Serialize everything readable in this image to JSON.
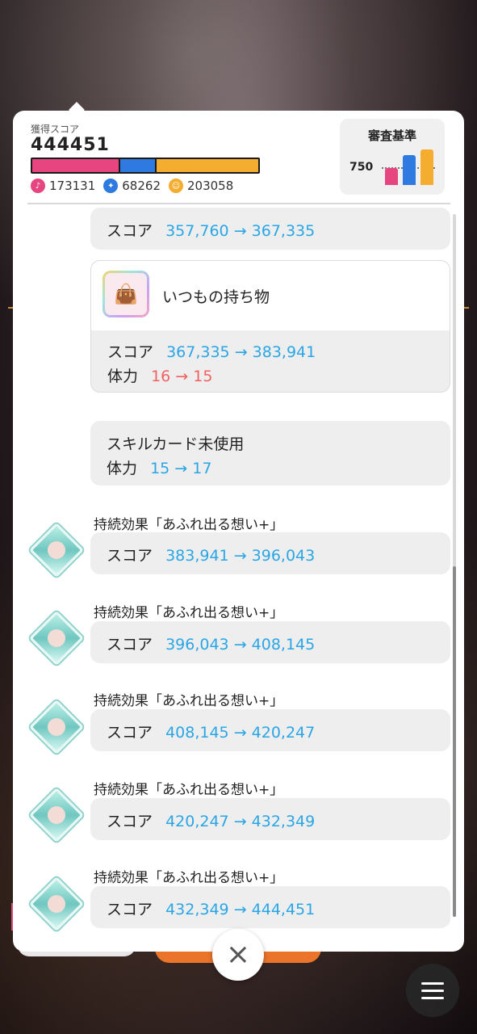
{
  "header": {
    "score_label": "獲得スコア",
    "score_value": "444451",
    "bar_segments": [
      {
        "color": "#e6457f",
        "fraction": 0.389
      },
      {
        "color": "#2f7ae0",
        "fraction": 0.154
      },
      {
        "color": "#f4ad2f",
        "fraction": 0.457
      }
    ],
    "stats": [
      {
        "icon": "microphone-icon",
        "color": "#e6457f",
        "value": "173131"
      },
      {
        "icon": "dance-icon",
        "color": "#2f7ae0",
        "value": "68262"
      },
      {
        "icon": "visual-icon",
        "color": "#f4ad2f",
        "value": "203058"
      }
    ],
    "criteria": {
      "title": "審査基準",
      "value": "750",
      "bars": [
        {
          "color": "#e6457f",
          "level": 0.45
        },
        {
          "color": "#2f7ae0",
          "level": 0.8
        },
        {
          "color": "#f4ad2f",
          "level": 0.95
        }
      ]
    }
  },
  "log": {
    "score_label": "スコア",
    "stamina_label": "体力",
    "arrow": "→",
    "entry0": {
      "score_from": "357,760",
      "score_to": "367,335"
    },
    "item": {
      "name": "いつもの持ち物",
      "icon": "bag-icon",
      "score_from": "367,335",
      "score_to": "383,941",
      "stamina_from": "16",
      "stamina_to": "15"
    },
    "skip": {
      "title": "スキルカード未使用",
      "stamina_from": "15",
      "stamina_to": "17"
    },
    "effects": [
      {
        "title": "持続効果「あふれ出る想い+」",
        "score_from": "383,941",
        "score_to": "396,043"
      },
      {
        "title": "持続効果「あふれ出る想い+」",
        "score_from": "396,043",
        "score_to": "408,145"
      },
      {
        "title": "持続効果「あふれ出る想い+」",
        "score_from": "408,145",
        "score_to": "420,247"
      },
      {
        "title": "持続効果「あふれ出る想い+」",
        "score_from": "420,247",
        "score_to": "432,349"
      },
      {
        "title": "持続効果「あふれ出る想い+」",
        "score_from": "432,349",
        "score_to": "444,451"
      }
    ]
  },
  "controls": {
    "close_icon": "close-icon",
    "close_glyph": "×",
    "menu_icon": "menu-icon"
  },
  "colors": {
    "accent_blue": "#2aa6e6",
    "accent_red": "#f06262"
  }
}
